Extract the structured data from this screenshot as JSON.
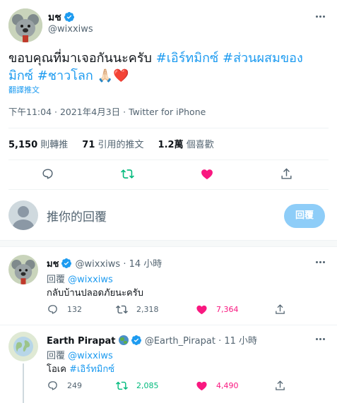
{
  "main_tweet": {
    "display_name": "มช",
    "handle": "@wixxiws",
    "text_line1_plain": "ขอบคุณที่มาเจอกันนะครับ",
    "hashtag1": "#เอิร์ทมิกซ์",
    "hashtag2_part1": "#ส่วนผสมของ",
    "hashtag2_part2": "มิกซ์",
    "hashtag3": "#ชาวโลก",
    "emoji": "🙏🏻❤️",
    "translate": "翻譯推文",
    "timestamp": "下午11:04 · 2021年4月3日",
    "separator": " · ",
    "source": "Twitter for iPhone",
    "stats": {
      "retweets_value": "5,150",
      "retweets_label": "則轉推",
      "quotes_value": "71",
      "quotes_label": "引用的推文",
      "likes_value": "1.2萬",
      "likes_label": "個喜歡"
    }
  },
  "reply_box": {
    "placeholder": "推你的回覆",
    "button": "回覆"
  },
  "replies": [
    {
      "display_name": "มช",
      "handle": "@wixxiws",
      "time": "· 14 小時",
      "reply_to_prefix": "回覆",
      "reply_to": "@wixxiws",
      "text": "กลับบ้านปลอดภัยนะครับ",
      "replies": "132",
      "retweets": "2,318",
      "likes": "7,364"
    },
    {
      "display_name": "Earth Pirapat",
      "handle": "@Earth_Pirapat",
      "time": "· 11 小時",
      "reply_to_prefix": "回覆",
      "reply_to": "@wixxiws",
      "text_plain": "โอเค",
      "text_hashtag": "#เอิร์ทมิกซ์",
      "replies": "249",
      "retweets": "2,085",
      "likes": "4,490"
    }
  ],
  "colors": {
    "accent": "#1d9bf0",
    "retweet_green": "#00ba7c",
    "like_red": "#f91880",
    "text_gray": "#536471"
  }
}
